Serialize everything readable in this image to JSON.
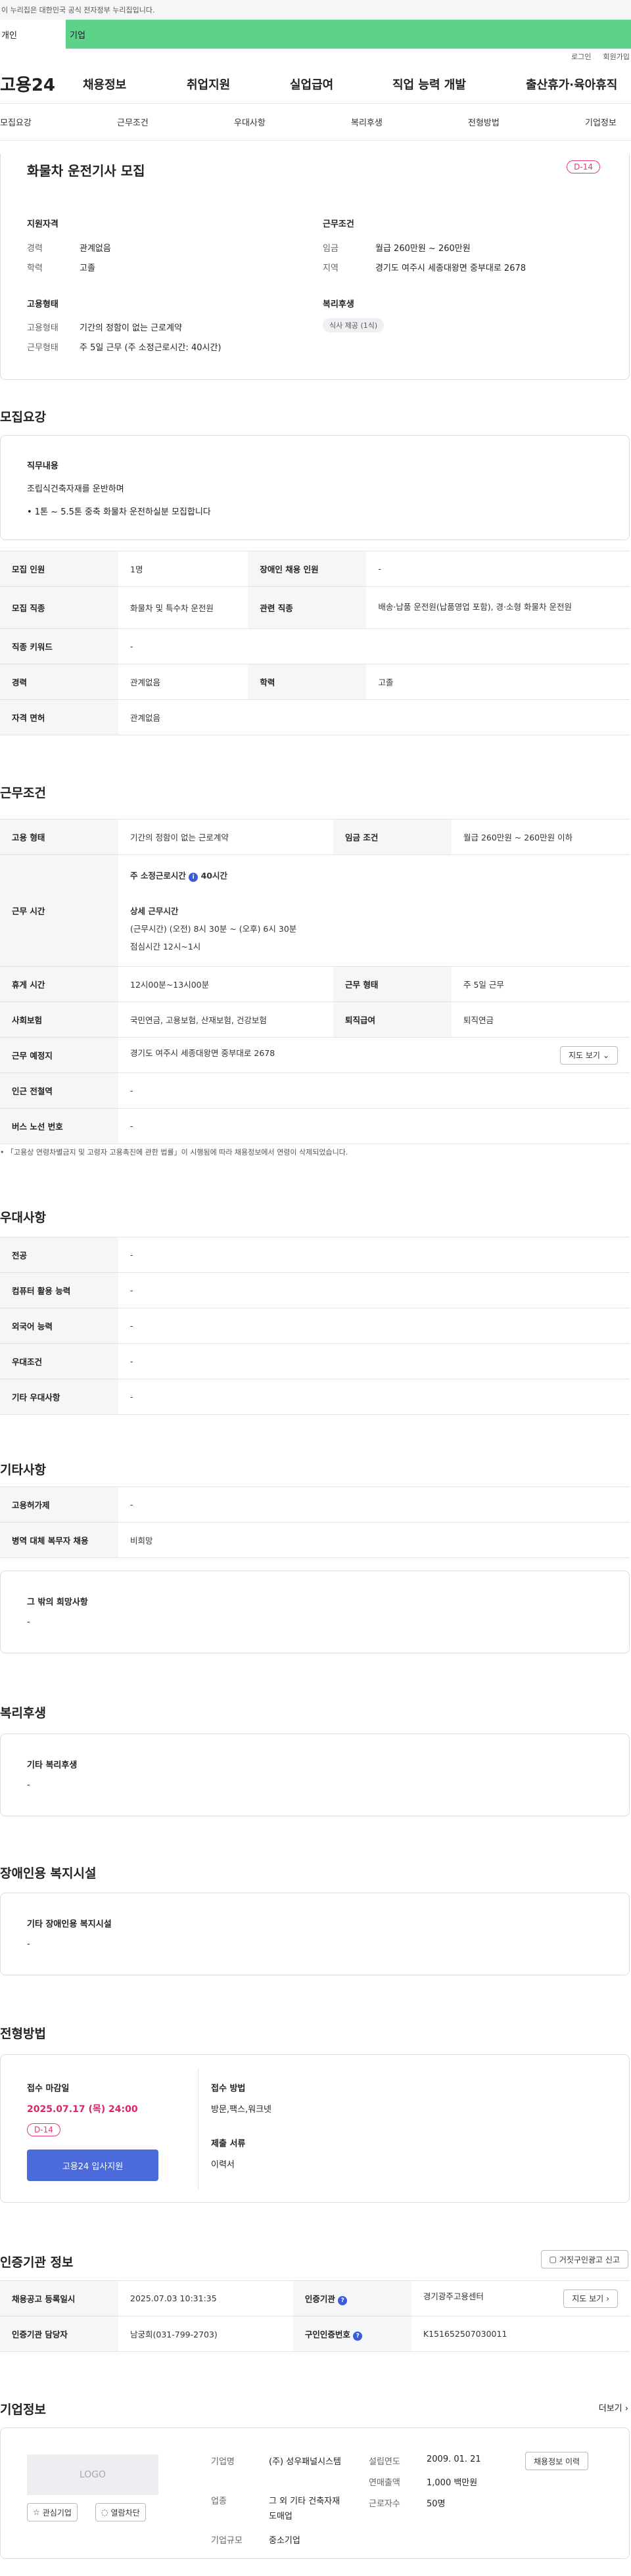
{
  "gov_banner": "이 누리집은 대한민국 공식 전자정부 누리집입니다.",
  "user_tabs": [
    "개인",
    "기업"
  ],
  "util": [
    "로그인",
    "회원가입"
  ],
  "logo": "고용24",
  "gnb": [
    "채용정보",
    "취업지원",
    "실업급여",
    "직업 능력 개발",
    "출산휴가·육아휴직"
  ],
  "anchors": [
    "모집요강",
    "근무조건",
    "우대사항",
    "복리후생",
    "전형방법",
    "기업정보"
  ],
  "summary": {
    "title": "화물차 운전기사 모집",
    "dday": "D-14",
    "qual_title": "지원자격",
    "career_k": "경력",
    "career_v": "관계없음",
    "edu_k": "학력",
    "edu_v": "고졸",
    "cond_title": "근무조건",
    "wage_k": "임금",
    "wage_v": "월급 260만원 ~ 260만원",
    "area_k": "지역",
    "area_v": "경기도 여주시 세종대왕면 중부대로 2678",
    "emp_title": "고용형태",
    "emptype_k": "고용형태",
    "emptype_v": "기간의 정함이 없는 근로계약",
    "work_k": "근무형태",
    "work_v": "주 5일 근무 (주 소정근로시간: 40시간)",
    "welfare_title": "복리후생",
    "welfare_chip": "식사 제공 (1식)"
  },
  "recruit": {
    "title": "모집요강",
    "duty_title": "직무내용",
    "duty_1": "조립식건축자재를  운반하며",
    "duty_2": "• 1톤 ~ 5.5톤 중축 화물차 운전하실분  모집합니다",
    "rows": [
      [
        "모집 인원",
        "1명",
        "장애인 채용 인원",
        "-"
      ],
      [
        "모집 직종",
        "화물차 및 특수차 운전원",
        "관련 직종",
        "배송·납품 운전원(납품영업 포함), 경·소형 화물차 운전원"
      ],
      [
        "직종 키워드",
        "-"
      ],
      [
        "경력",
        "관계없음",
        "학력",
        "고졸"
      ],
      [
        "자격 면허",
        "관계없음"
      ]
    ]
  },
  "work": {
    "title": "근무조건",
    "r1": [
      "고용 형태",
      "기간의 정함이 없는 근로계약",
      "임금 조건",
      "월급 260만원 ~ 260만원 이하"
    ],
    "hours_k": "근무 시간",
    "hours_main": "주 소정근로시간",
    "hours_badge": "40시간",
    "hours_detail_t": "상세 근무시간",
    "hours_detail_1": "(근무시간) (오전) 8시 30분 ~ (오후) 6시 30분",
    "hours_detail_2": "점심시간 12시~1시",
    "r3": [
      "휴게 시간",
      "12시00분~13시00분",
      "근무 형태",
      "주 5일 근무"
    ],
    "r4": [
      "사회보험",
      "국민연금, 고용보험, 산재보험, 건강보험",
      "퇴직급여",
      "퇴직연금"
    ],
    "place_k": "근무 예정지",
    "place_v": "경기도 여주시 세종대왕면 중부대로 2678",
    "map_btn": "지도 보기",
    "subway_k": "인근 전철역",
    "subway_v": "-",
    "bus_k": "버스 노선 번호",
    "bus_v": "-",
    "note": "• 「고용상 연령차별금지 및 고령자 고용촉진에 관한 법률」이 시행됨에 따라 채용정보에서 연령이 삭제되었습니다."
  },
  "pref": {
    "title": "우대사항",
    "rows": [
      [
        "전공",
        "-"
      ],
      [
        "컴퓨터 활용 능력",
        "-"
      ],
      [
        "외국어 능력",
        "-"
      ],
      [
        "우대조건",
        "-"
      ],
      [
        "기타 우대사항",
        "-"
      ]
    ]
  },
  "etc": {
    "title": "기타사항",
    "rows": [
      [
        "고용허가제",
        "-"
      ],
      [
        "병역 대체 복무자 채용",
        "비희망"
      ]
    ],
    "other_t": "그 밖의 희망사항",
    "other_v": "-"
  },
  "welfare": {
    "title": "복리후생",
    "sub": "기타 복리후생",
    "v": "-"
  },
  "disab": {
    "title": "장애인용 복지시설",
    "sub": "기타 장애인용 복지시설",
    "v": "-"
  },
  "process": {
    "title": "전형방법",
    "deadline_k": "접수 마감일",
    "deadline_v": "2025.07.17 (목) 24:00",
    "dday": "D-14",
    "apply_btn": "고용24 입사지원",
    "method_k": "접수 방법",
    "method_v": "방문,팩스,워크넷",
    "docs_k": "제출 서류",
    "docs_v": "이력서"
  },
  "cert": {
    "title": "인증기관 정보",
    "report_btn": "거짓구인광고 신고",
    "reg_k": "채용공고 등록일시",
    "reg_v": "2025.07.03 10:31:35",
    "org_k": "인증기관",
    "org_v": "경기광주고용센터",
    "map_btn": "지도 보기",
    "mgr_k": "인증기관 담당자",
    "mgr_v": "남궁희(031-799-2703)",
    "id_k": "구인인증번호",
    "id_v": "K151652507030011"
  },
  "company": {
    "title": "기업정보",
    "more": "더보기",
    "logo": "LOGO",
    "fav_btn": "관심기업",
    "block_btn": "열람차단",
    "name_k": "기업명",
    "name_v": "(주) 성우패널시스템",
    "industry_k": "업종",
    "industry_v": "그 외 기타 건축자재 도매업",
    "size_k": "기업규모",
    "size_v": "중소기업",
    "year_k": "설립연도",
    "year_v": "2009. 01. 21",
    "sales_k": "연매출액",
    "sales_v": "1,000 백만원",
    "staff_k": "근로자수",
    "staff_v": "50명",
    "hire_btn": "채용정보 이력"
  }
}
